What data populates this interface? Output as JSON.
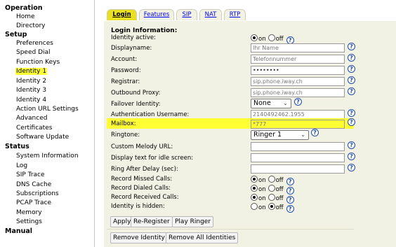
{
  "nav": {
    "sections": [
      {
        "title": "Operation",
        "items": [
          "Home",
          "Directory"
        ]
      },
      {
        "title": "Setup",
        "items": [
          "Preferences",
          "Speed Dial",
          "Function Keys",
          "Identity 1",
          "Identity 2",
          "Identity 3",
          "Identity 4",
          "Action URL Settings",
          "Advanced",
          "Certificates",
          "Software Update"
        ]
      },
      {
        "title": "Status",
        "items": [
          "System Information",
          "Log",
          "SIP Trace",
          "DNS Cache",
          "Subscriptions",
          "PCAP Trace",
          "Memory",
          "Settings"
        ]
      },
      {
        "title": "Manual",
        "items": []
      }
    ],
    "selected": "Identity 1"
  },
  "tabs": [
    {
      "label": "Login",
      "active": true
    },
    {
      "label": "Features",
      "active": false
    },
    {
      "label": "SIP",
      "active": false
    },
    {
      "label": "NAT",
      "active": false
    },
    {
      "label": "RTP",
      "active": false
    }
  ],
  "form": {
    "section_title": "Login Information:",
    "identity_active": {
      "label": "Identity active:",
      "on": "on",
      "off": "off",
      "value": "on"
    },
    "displayname": {
      "label": "Displayname:",
      "value": "Ihr Name"
    },
    "account": {
      "label": "Account:",
      "value": "Telefonnummer"
    },
    "password": {
      "label": "Password:",
      "value": "••••••••"
    },
    "registrar": {
      "label": "Registrar:",
      "value": "sip.phone.iway.ch"
    },
    "outbound_proxy": {
      "label": "Outbound Proxy:",
      "value": "sip.phone.iway.ch"
    },
    "failover_identity": {
      "label": "Failover Identity:",
      "value": "None"
    },
    "auth_username": {
      "label": "Authentication Username:",
      "value": "2140492462.1955"
    },
    "mailbox": {
      "label": "Mailbox:",
      "value": "*777"
    },
    "ringtone": {
      "label": "Ringtone:",
      "value": "Ringer 1"
    },
    "custom_melody": {
      "label": "Custom Melody URL:",
      "value": ""
    },
    "idle_text": {
      "label": "Display text for idle screen:",
      "value": ""
    },
    "ring_after_delay": {
      "label": "Ring After Delay (sec):",
      "value": ""
    },
    "record_missed": {
      "label": "Record Missed Calls:",
      "on": "on",
      "off": "off",
      "value": "on"
    },
    "record_dialed": {
      "label": "Record Dialed Calls:",
      "on": "on",
      "off": "off",
      "value": "on"
    },
    "record_received": {
      "label": "Record Received Calls:",
      "on": "on",
      "off": "off",
      "value": "on"
    },
    "identity_hidden": {
      "label": "Identity is hidden:",
      "on": "on",
      "off": "off",
      "value": "off"
    }
  },
  "buttons": {
    "apply": "Apply",
    "re_register": "Re-Register",
    "play_ringer": "Play Ringer",
    "remove_identity": "Remove Identity",
    "remove_all": "Remove All Identities"
  },
  "help_glyph": "?",
  "colors": {
    "highlight": "#ffff33",
    "tab_active": "#e8e020",
    "panel_bg": "#f2f2e4",
    "help": "#1a4aa8"
  }
}
